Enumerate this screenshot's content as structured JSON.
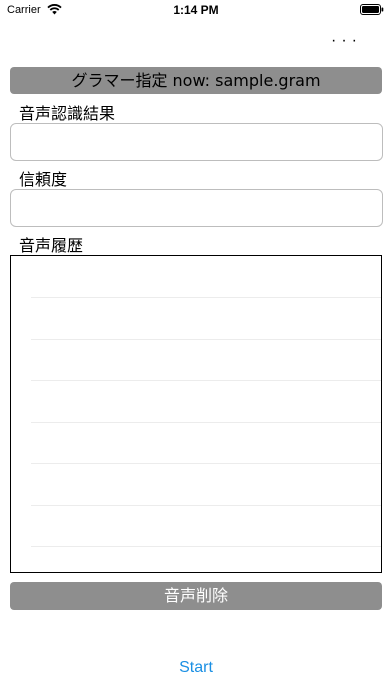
{
  "status_bar": {
    "carrier": "Carrier",
    "time": "1:14 PM",
    "wifi_icon": "wifi-icon",
    "battery_icon": "battery-icon"
  },
  "toolbar": {
    "more_label": "···"
  },
  "grammar_button": {
    "label": "グラマー指定 now: sample.gram"
  },
  "labels": {
    "recognition_result": "音声認識結果",
    "confidence": "信頼度",
    "history": "音声履歴"
  },
  "fields": {
    "recognition_result_value": "",
    "confidence_value": ""
  },
  "history_rows": 7,
  "delete_button": {
    "label": "音声削除"
  },
  "start_button": {
    "label": "Start"
  },
  "colors": {
    "button_gray": "#8e8e8e",
    "accent_blue": "#1a8fe3"
  }
}
